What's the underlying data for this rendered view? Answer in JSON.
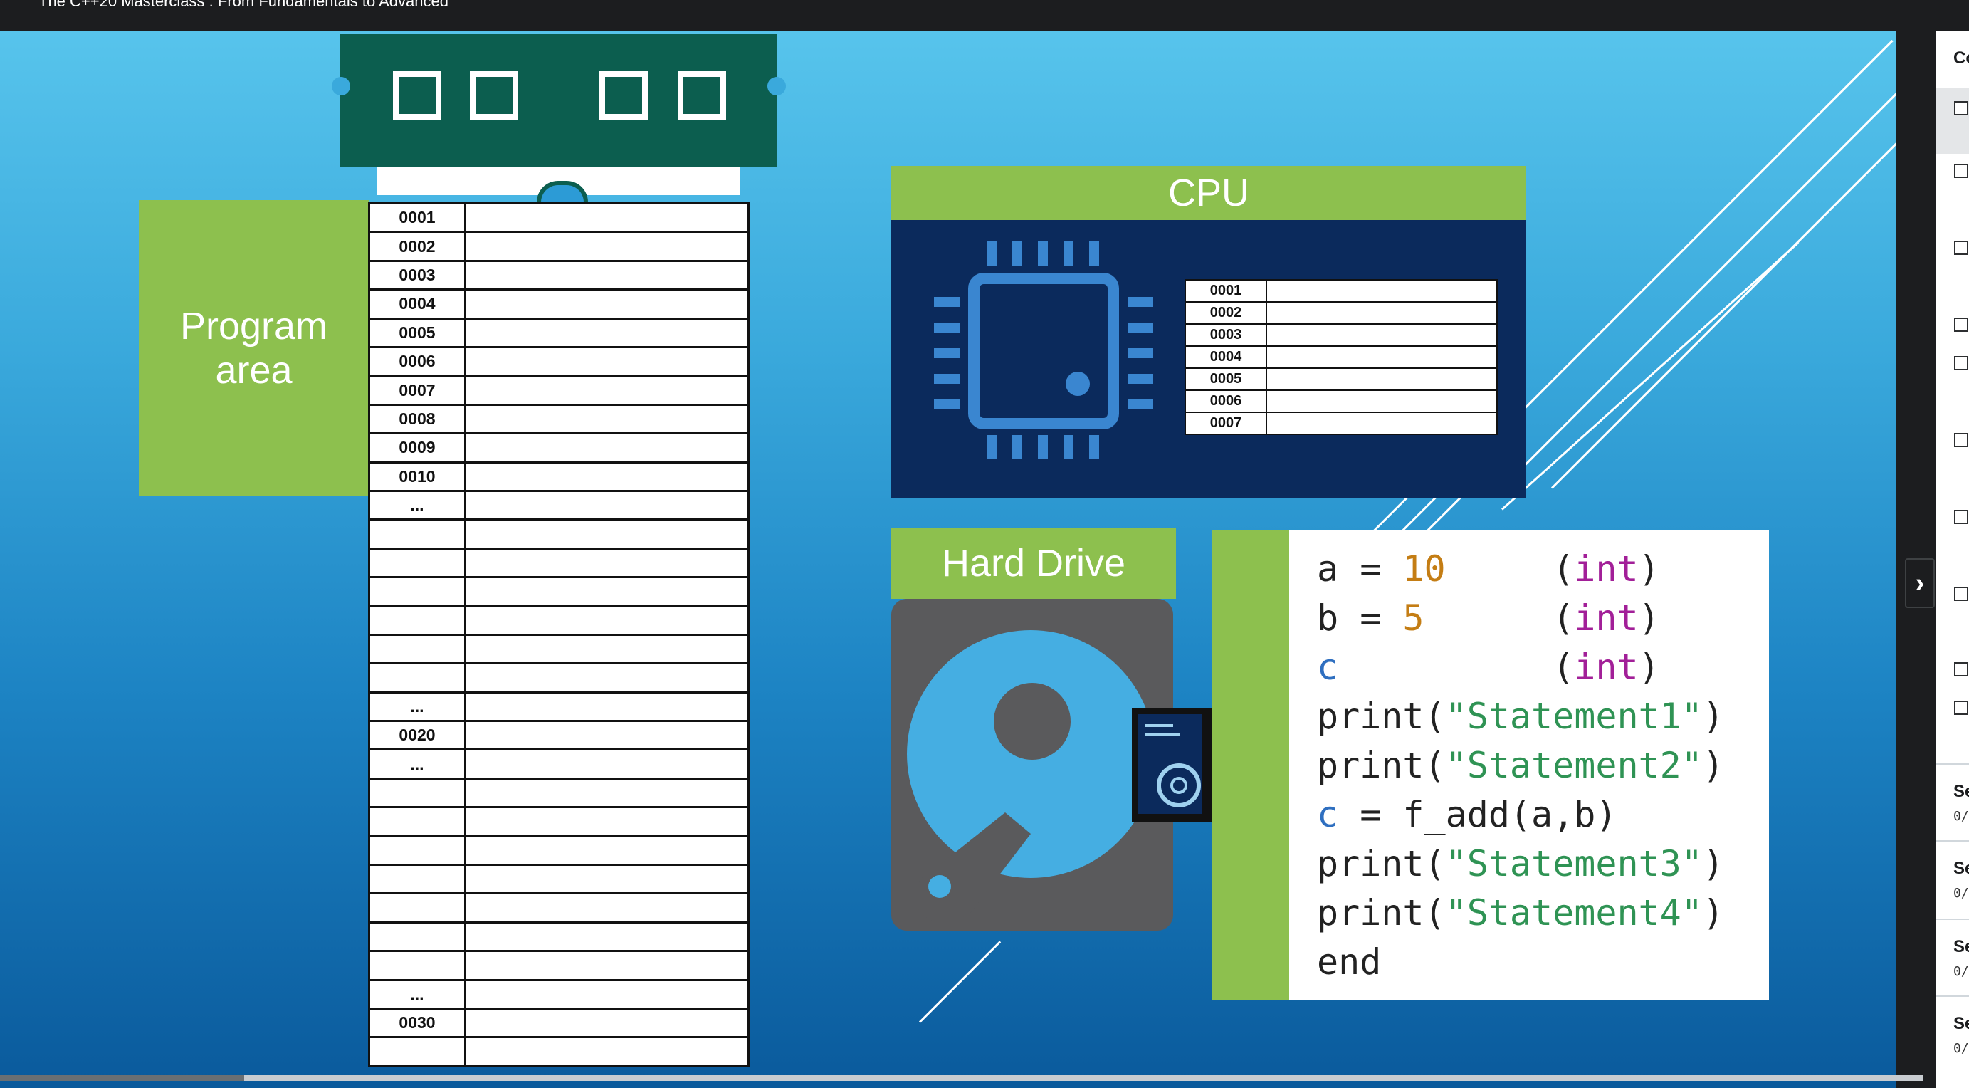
{
  "header": {
    "course_title": "The C++20 Masterclass : From Fundamentals to Advanced"
  },
  "video": {
    "program_area_label": "Program area",
    "memory_rows": [
      "0001",
      "0002",
      "0003",
      "0004",
      "0005",
      "0006",
      "0007",
      "0008",
      "0009",
      "0010",
      "...",
      "",
      "",
      "",
      "",
      "",
      "",
      "...",
      "0020",
      "...",
      "",
      "",
      "",
      "",
      "",
      "",
      "",
      "...",
      "0030",
      ""
    ],
    "cpu_label": "CPU",
    "cpu_registers": [
      "0001",
      "0002",
      "0003",
      "0004",
      "0005",
      "0006",
      "0007"
    ],
    "hard_drive_label": "Hard Drive",
    "code": {
      "l1": {
        "a": "a = ",
        "b": "10",
        "c": "     (",
        "d": "int",
        "e": ")"
      },
      "l2": {
        "a": "b = ",
        "b": "5",
        "c": "      (",
        "d": "int",
        "e": ")"
      },
      "l3": {
        "a": "c",
        "c": "          (",
        "d": "int",
        "e": ")"
      },
      "l4": {
        "a": "print(",
        "s": "\"Statement1\"",
        "e": ")"
      },
      "l5": {
        "a": "print(",
        "s": "\"Statement2\"",
        "e": ")"
      },
      "l6": {
        "v": "c",
        "a": " = f_add(a,b)"
      },
      "l7": {
        "a": "print(",
        "s": "\"Statement3\"",
        "e": ")"
      },
      "l8": {
        "a": "print(",
        "s": "\"Statement4\"",
        "e": ")"
      },
      "l9": {
        "a": "end"
      }
    },
    "progress_fraction": 0.127
  },
  "sidebar": {
    "heading": "Co",
    "sections": [
      {
        "title": "Se",
        "progress": "0/"
      },
      {
        "title": "Se",
        "progress": "0/"
      },
      {
        "title": "Se",
        "progress": "0/"
      },
      {
        "title": "Se",
        "progress": "0/"
      }
    ],
    "toggle_icon": "chevron-right-icon"
  },
  "colors": {
    "accent_green": "#8dc04e",
    "ram_green": "#0c5e4f",
    "cpu_navy": "#0b2a5c",
    "icon_blue": "#3a86d0",
    "drive_gray": "#5a5a5c"
  }
}
